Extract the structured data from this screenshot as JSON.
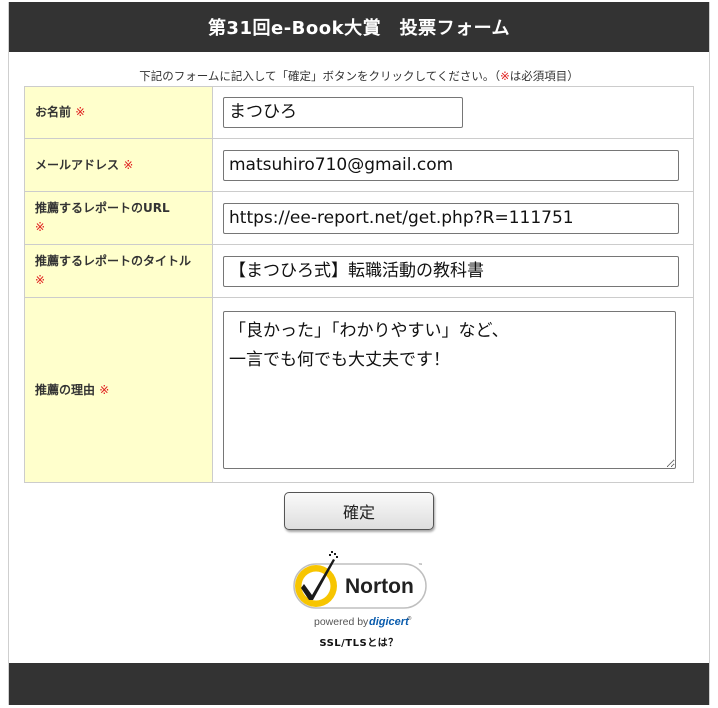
{
  "header": {
    "title": "第31回e-Book大賞　投票フォーム"
  },
  "intro": {
    "text": "下記のフォームに記入して「確定」ボタンをクリックしてください。（",
    "req_mark": "※",
    "suffix": "は必須項目）"
  },
  "form": {
    "required_mark": "※",
    "name": {
      "label": "お名前",
      "value": "まつひろ"
    },
    "email": {
      "label": "メールアドレス",
      "value": "matsuhiro710@gmail.com"
    },
    "report_url": {
      "label": "推薦するレポートのURL",
      "value": "https://ee-report.net/get.php?R=111751"
    },
    "report_title": {
      "label": "推薦するレポートのタイトル",
      "value": "【まつひろ式】転職活動の教科書"
    },
    "reason": {
      "label": "推薦の理由",
      "value": "「良かった」「わかりやすい」など、\n一言でも何でも大丈夫です！"
    }
  },
  "submit": {
    "label": "確定"
  },
  "seal": {
    "brand": "Norton",
    "powered_by": "powered by",
    "provider": "digicert",
    "tm": "™",
    "reg": "®",
    "check_color": "#f7c500",
    "ring_color": "#1a1a1a",
    "provider_color": "#0a5cad"
  },
  "ssl_link": {
    "label": "SSL/TLSとは？"
  }
}
